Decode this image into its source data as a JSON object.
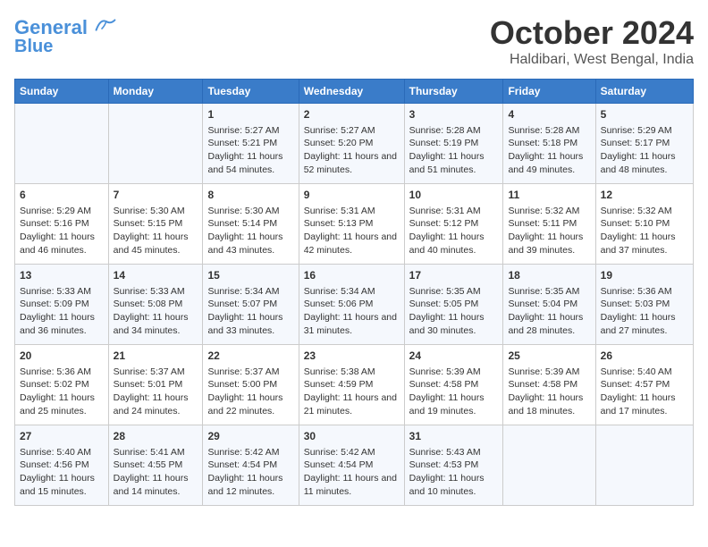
{
  "header": {
    "logo_line1": "General",
    "logo_line2": "Blue",
    "month": "October 2024",
    "location": "Haldibari, West Bengal, India"
  },
  "days_of_week": [
    "Sunday",
    "Monday",
    "Tuesday",
    "Wednesday",
    "Thursday",
    "Friday",
    "Saturday"
  ],
  "weeks": [
    [
      {
        "day": "",
        "info": ""
      },
      {
        "day": "",
        "info": ""
      },
      {
        "day": "1",
        "info": "Sunrise: 5:27 AM\nSunset: 5:21 PM\nDaylight: 11 hours and 54 minutes."
      },
      {
        "day": "2",
        "info": "Sunrise: 5:27 AM\nSunset: 5:20 PM\nDaylight: 11 hours and 52 minutes."
      },
      {
        "day": "3",
        "info": "Sunrise: 5:28 AM\nSunset: 5:19 PM\nDaylight: 11 hours and 51 minutes."
      },
      {
        "day": "4",
        "info": "Sunrise: 5:28 AM\nSunset: 5:18 PM\nDaylight: 11 hours and 49 minutes."
      },
      {
        "day": "5",
        "info": "Sunrise: 5:29 AM\nSunset: 5:17 PM\nDaylight: 11 hours and 48 minutes."
      }
    ],
    [
      {
        "day": "6",
        "info": "Sunrise: 5:29 AM\nSunset: 5:16 PM\nDaylight: 11 hours and 46 minutes."
      },
      {
        "day": "7",
        "info": "Sunrise: 5:30 AM\nSunset: 5:15 PM\nDaylight: 11 hours and 45 minutes."
      },
      {
        "day": "8",
        "info": "Sunrise: 5:30 AM\nSunset: 5:14 PM\nDaylight: 11 hours and 43 minutes."
      },
      {
        "day": "9",
        "info": "Sunrise: 5:31 AM\nSunset: 5:13 PM\nDaylight: 11 hours and 42 minutes."
      },
      {
        "day": "10",
        "info": "Sunrise: 5:31 AM\nSunset: 5:12 PM\nDaylight: 11 hours and 40 minutes."
      },
      {
        "day": "11",
        "info": "Sunrise: 5:32 AM\nSunset: 5:11 PM\nDaylight: 11 hours and 39 minutes."
      },
      {
        "day": "12",
        "info": "Sunrise: 5:32 AM\nSunset: 5:10 PM\nDaylight: 11 hours and 37 minutes."
      }
    ],
    [
      {
        "day": "13",
        "info": "Sunrise: 5:33 AM\nSunset: 5:09 PM\nDaylight: 11 hours and 36 minutes."
      },
      {
        "day": "14",
        "info": "Sunrise: 5:33 AM\nSunset: 5:08 PM\nDaylight: 11 hours and 34 minutes."
      },
      {
        "day": "15",
        "info": "Sunrise: 5:34 AM\nSunset: 5:07 PM\nDaylight: 11 hours and 33 minutes."
      },
      {
        "day": "16",
        "info": "Sunrise: 5:34 AM\nSunset: 5:06 PM\nDaylight: 11 hours and 31 minutes."
      },
      {
        "day": "17",
        "info": "Sunrise: 5:35 AM\nSunset: 5:05 PM\nDaylight: 11 hours and 30 minutes."
      },
      {
        "day": "18",
        "info": "Sunrise: 5:35 AM\nSunset: 5:04 PM\nDaylight: 11 hours and 28 minutes."
      },
      {
        "day": "19",
        "info": "Sunrise: 5:36 AM\nSunset: 5:03 PM\nDaylight: 11 hours and 27 minutes."
      }
    ],
    [
      {
        "day": "20",
        "info": "Sunrise: 5:36 AM\nSunset: 5:02 PM\nDaylight: 11 hours and 25 minutes."
      },
      {
        "day": "21",
        "info": "Sunrise: 5:37 AM\nSunset: 5:01 PM\nDaylight: 11 hours and 24 minutes."
      },
      {
        "day": "22",
        "info": "Sunrise: 5:37 AM\nSunset: 5:00 PM\nDaylight: 11 hours and 22 minutes."
      },
      {
        "day": "23",
        "info": "Sunrise: 5:38 AM\nSunset: 4:59 PM\nDaylight: 11 hours and 21 minutes."
      },
      {
        "day": "24",
        "info": "Sunrise: 5:39 AM\nSunset: 4:58 PM\nDaylight: 11 hours and 19 minutes."
      },
      {
        "day": "25",
        "info": "Sunrise: 5:39 AM\nSunset: 4:58 PM\nDaylight: 11 hours and 18 minutes."
      },
      {
        "day": "26",
        "info": "Sunrise: 5:40 AM\nSunset: 4:57 PM\nDaylight: 11 hours and 17 minutes."
      }
    ],
    [
      {
        "day": "27",
        "info": "Sunrise: 5:40 AM\nSunset: 4:56 PM\nDaylight: 11 hours and 15 minutes."
      },
      {
        "day": "28",
        "info": "Sunrise: 5:41 AM\nSunset: 4:55 PM\nDaylight: 11 hours and 14 minutes."
      },
      {
        "day": "29",
        "info": "Sunrise: 5:42 AM\nSunset: 4:54 PM\nDaylight: 11 hours and 12 minutes."
      },
      {
        "day": "30",
        "info": "Sunrise: 5:42 AM\nSunset: 4:54 PM\nDaylight: 11 hours and 11 minutes."
      },
      {
        "day": "31",
        "info": "Sunrise: 5:43 AM\nSunset: 4:53 PM\nDaylight: 11 hours and 10 minutes."
      },
      {
        "day": "",
        "info": ""
      },
      {
        "day": "",
        "info": ""
      }
    ]
  ]
}
